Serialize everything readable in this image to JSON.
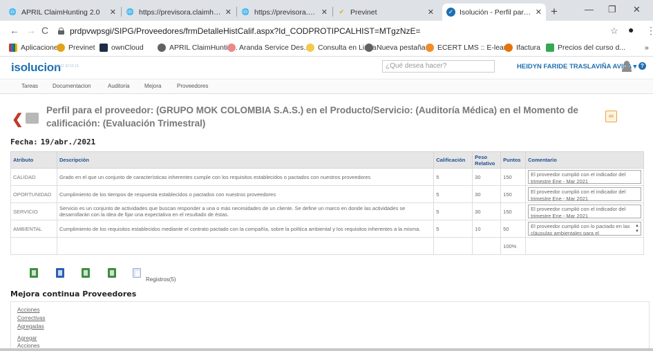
{
  "browser": {
    "tabs": [
      {
        "label": "APRIL ClaimHunting 2.0",
        "icon": "globe-icon",
        "active": false
      },
      {
        "label": "https://previsora.claimhunt",
        "icon": "globe-icon",
        "active": false
      },
      {
        "label": "https://previsora.claimhunt",
        "icon": "globe-icon",
        "active": false
      },
      {
        "label": "Previnet",
        "icon": "previnet-icon",
        "active": false
      },
      {
        "label": "Isolución - Perfil para el pro",
        "icon": "isolucion-icon",
        "active": true
      }
    ],
    "url": "prdpvwpsgi/SIPG/Proveedores/frmDetalleHistCalif.aspx?Id_CODPROTIPCALHIST=MTgzNzE=",
    "bookmarks": [
      "Aplicaciones",
      "Previnet",
      "ownCloud",
      "APRIL ClaimHuntin...",
      "Aranda Service Des...",
      "Consulta en Linea",
      "Nueva pestaña",
      "ECERT LMS :: E-lear...",
      "Ifactura",
      "Precios del curso d..."
    ],
    "more_bookmarks": "»"
  },
  "header": {
    "logo": "isolucion",
    "logo_sub": "4.8.21 92.15.15",
    "search_placeholder": "¿Qué desea hacer?",
    "user_name": "HEIDYN FARIDE TRASLAVIÑA AVILA ▾"
  },
  "menu": [
    "Tareas",
    "Documentacion",
    "Auditoria",
    "Mejora",
    "Proveedores"
  ],
  "page": {
    "title": "Perfil para el proveedor: (GRUPO MOK COLOMBIA S.A.S.) en el Producto/Servicio: (Auditoría Médica) en el Momento de calificación: (Evaluación Trimestral)",
    "fecha_label": "Fecha:",
    "fecha_value": "19/abr./2021"
  },
  "table": {
    "headers": {
      "atributo": "Atributo",
      "descripcion": "Descripción",
      "calificacion": "Calificación",
      "peso": "Peso Relativo",
      "puntos": "Puntos",
      "comentario": "Comentario"
    },
    "rows": [
      {
        "atributo": "CALIDAD",
        "descripcion": "Grado en el que un conjunto de características inherentes cumple con los requisitos establecidos o pactados con nuestros proveedores",
        "calificacion": "5",
        "peso": "30",
        "puntos": "150",
        "comentario": "El proveedor cumplió con el indicador del trimestre Ene - Mar 2021"
      },
      {
        "atributo": "OPORTUNIDAD",
        "descripcion": "Cumplimiento de los tiempos de respuesta establecidos o pactados con nuestros proveedores",
        "calificacion": "5",
        "peso": "30",
        "puntos": "150",
        "comentario": "El proveedor cumplió con el indicador del trimestre Ene - Mar 2021"
      },
      {
        "atributo": "SERVICIO",
        "descripcion": "Servicio es un conjunto de actividades que buscan responder a una o más necesidades de un cliente. Se define un marco en donde las actividades se desarrollarán con la idea de fijar una expectativa en el resultado de éstas.",
        "calificacion": "5",
        "peso": "30",
        "puntos": "150",
        "comentario": "El proveedor cumplió con el indicador del trimestre Ene - Mar 2021"
      },
      {
        "atributo": "AMBIENTAL",
        "descripcion": "Cumplimiento de los requisitos establecidos mediante el contrato pactado con la compañía, sobre la política ambiental y los requisitos inherentes a la misma.",
        "calificacion": "5",
        "peso": "10",
        "puntos": "50",
        "comentario": "El proveedor cumplió con lo pactado en las cláusulas ambientales para el"
      }
    ],
    "total_puntos": "100%"
  },
  "export": {
    "icons": [
      "excel-export-icon",
      "word-export-icon",
      "excel-export-icon",
      "excel-export-icon",
      "broken-image-icon"
    ],
    "registros": "Registros(5)"
  },
  "mejora": {
    "title": "Mejora continua Proveedores",
    "links": [
      {
        "lines": [
          "Acciones",
          "Correctivas",
          "Agregadas"
        ]
      },
      {
        "lines": [
          "Agregar",
          "Acciones"
        ]
      }
    ]
  },
  "colors": {
    "accent": "#1f6fb2",
    "header_text": "#1f4e8c",
    "back_arrow": "#c0392b",
    "excel": "#3e8e41",
    "word": "#2b5fb4"
  }
}
